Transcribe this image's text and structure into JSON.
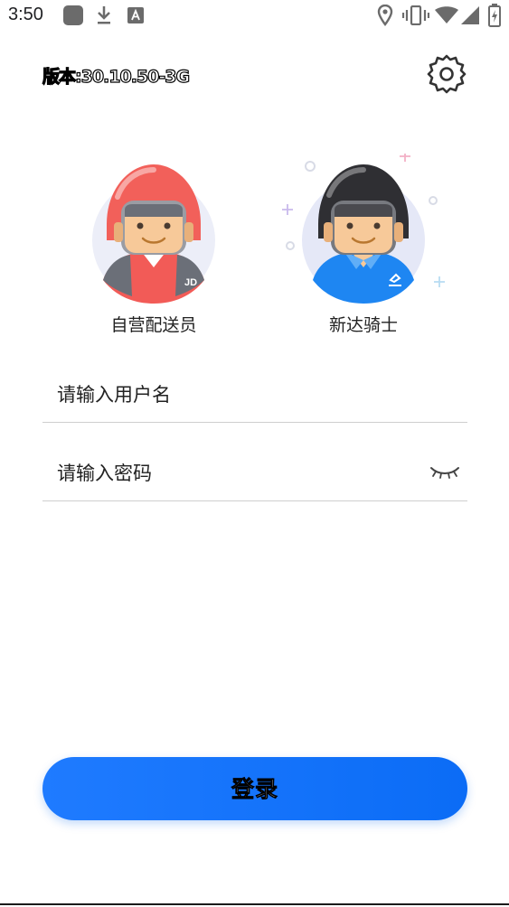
{
  "status_bar": {
    "time": "3:50",
    "icons": [
      "app-square-icon",
      "download-icon",
      "font-a-icon",
      "location-icon",
      "vibrate-icon",
      "wifi-icon",
      "signal-icon",
      "battery-charging-icon"
    ]
  },
  "header": {
    "version": "版本:30.10.50-3G",
    "settings_icon": "gear-icon"
  },
  "roles": [
    {
      "label": "自营配送员",
      "avatar": "red-helmet-courier-avatar"
    },
    {
      "label": "新达骑士",
      "avatar": "black-helmet-rider-avatar"
    }
  ],
  "form": {
    "username_placeholder": "请输入用户名",
    "password_placeholder": "请输入密码",
    "password_toggle_icon": "eye-closed-icon"
  },
  "login_button": {
    "label": "登录"
  },
  "colors": {
    "primary": "#1676ff",
    "role1_helmet": "#f2605a",
    "role2_shirt": "#1e86f2"
  }
}
